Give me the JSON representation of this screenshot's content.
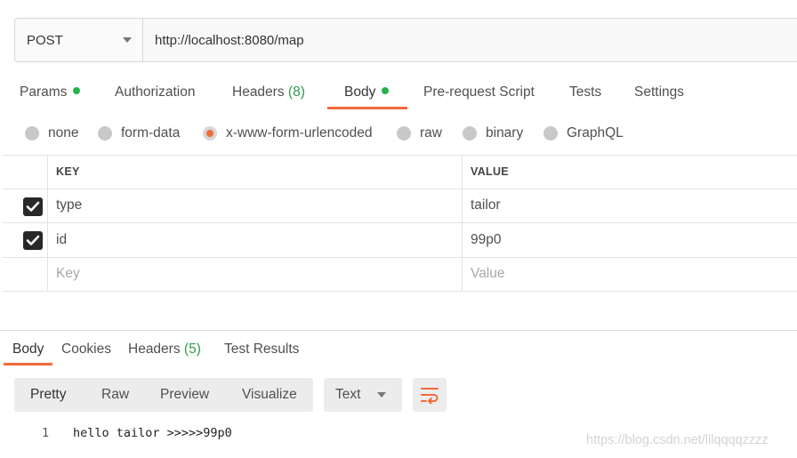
{
  "request": {
    "method": "POST",
    "url": "http://localhost:8080/map"
  },
  "request_tabs": [
    {
      "label": "Params",
      "count": "",
      "dot": true
    },
    {
      "label": "Authorization",
      "count": "",
      "dot": false
    },
    {
      "label": "Headers",
      "count": "(8)",
      "dot": false
    },
    {
      "label": "Body",
      "count": "",
      "dot": true,
      "active": true
    },
    {
      "label": "Pre-request Script",
      "count": "",
      "dot": false
    },
    {
      "label": "Tests",
      "count": "",
      "dot": false
    },
    {
      "label": "Settings",
      "count": "",
      "dot": false
    }
  ],
  "body_types": [
    {
      "label": "none",
      "selected": false
    },
    {
      "label": "form-data",
      "selected": false
    },
    {
      "label": "x-www-form-urlencoded",
      "selected": true
    },
    {
      "label": "raw",
      "selected": false
    },
    {
      "label": "binary",
      "selected": false
    },
    {
      "label": "GraphQL",
      "selected": false
    }
  ],
  "kv_table": {
    "columns": {
      "key": "KEY",
      "value": "VALUE"
    },
    "rows": [
      {
        "key": "type",
        "value": "tailor",
        "checked": true
      },
      {
        "key": "id",
        "value": "99p0",
        "checked": true
      }
    ],
    "placeholder": {
      "key": "Key",
      "value": "Value"
    }
  },
  "response_tabs": [
    {
      "label": "Body",
      "count": "",
      "active": true
    },
    {
      "label": "Cookies",
      "count": ""
    },
    {
      "label": "Headers",
      "count": "(5)"
    },
    {
      "label": "Test Results",
      "count": ""
    }
  ],
  "view_modes": [
    "Pretty",
    "Raw",
    "Preview",
    "Visualize"
  ],
  "active_view_mode": "Pretty",
  "format": "Text",
  "response_body": {
    "line_number": "1",
    "text": "hello tailor >>>>>99p0"
  },
  "watermark": "https://blog.csdn.net/lllqqqqzzzz",
  "colors": {
    "accent": "#f26b3a",
    "status_dot": "#26b24a",
    "count": "#2e9c4b"
  },
  "icons": {
    "method_dropdown": "chevron-down-icon",
    "checkbox": "check-icon",
    "wrap": "wrap-lines-icon"
  }
}
